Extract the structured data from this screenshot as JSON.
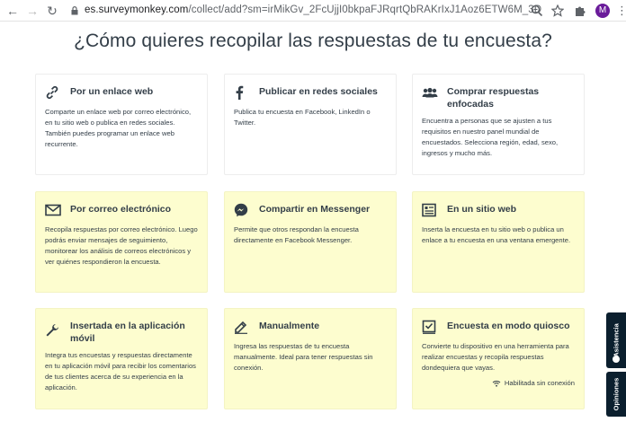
{
  "browser": {
    "url_host": "es.surveymonkey.com",
    "url_path": "/collect/add?sm=irMikGv_2FcUjjI0bkpaFJRqrtQbRAKrIxJ1Aoz6ETW6M_3D",
    "profile_initial": "M"
  },
  "page": {
    "title": "¿Cómo quieres recopilar las respuestas de tu encuesta?"
  },
  "cards": [
    {
      "title": "Por un enlace web",
      "desc": "Comparte un enlace web por correo electrónico, en tu sitio web o publica en redes sociales. También puedes programar un enlace web recurrente.",
      "icon": "link-icon"
    },
    {
      "title": "Publicar en redes sociales",
      "desc": "Publica tu encuesta en Facebook, LinkedIn o Twitter.",
      "icon": "facebook-icon"
    },
    {
      "title": "Comprar respuestas enfocadas",
      "desc": "Encuentra a personas que se ajusten a tus requisitos en nuestro panel mundial de encuestados. Selecciona región, edad, sexo, ingresos y mucho más.",
      "icon": "people-icon"
    },
    {
      "title": "Por correo electrónico",
      "desc": "Recopila respuestas por correo electrónico. Luego podrás enviar mensajes de seguimiento, monitorear los análisis de correos electrónicos y ver quiénes respondieron la encuesta.",
      "icon": "mail-icon"
    },
    {
      "title": "Compartir en Messenger",
      "desc": "Permite que otros respondan la encuesta directamente en Facebook Messenger.",
      "icon": "messenger-icon"
    },
    {
      "title": "En un sitio web",
      "desc": "Inserta la encuesta en tu sitio web o publica un enlace a tu encuesta en una ventana emergente.",
      "icon": "website-icon"
    },
    {
      "title": "Insertada en la aplicación móvil",
      "desc": "Integra tus encuestas y respuestas directamente en tu aplicación móvil para recibir los comentarios de tus clientes acerca de su experiencia en la aplicación.",
      "icon": "wrench-icon"
    },
    {
      "title": "Manualmente",
      "desc": "Ingresa las respuestas de tu encuesta manualmente. Ideal para tener respuestas sin conexión.",
      "icon": "pencil-icon"
    },
    {
      "title": "Encuesta en modo quiosco",
      "desc": "Convierte tu dispositivo en una herramienta para realizar encuestas y recopila respuestas dondequiera que vayas.",
      "icon": "kiosk-icon",
      "note": "Habilitada sin conexión"
    }
  ],
  "side_tabs": {
    "assistance": "Asistencia",
    "feedback": "Opiniones"
  }
}
